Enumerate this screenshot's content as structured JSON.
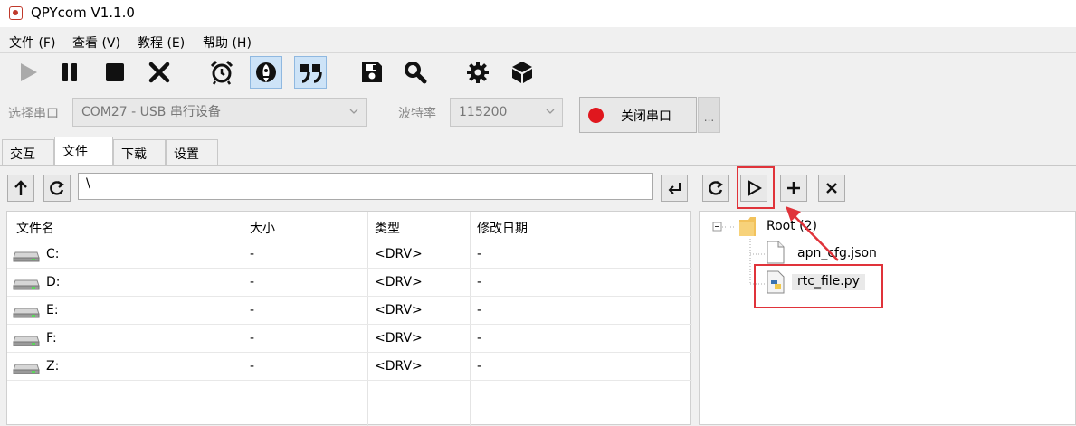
{
  "window": {
    "title": "QPYcom V1.1.0"
  },
  "menu": [
    "文件 (F)",
    "查看 (V)",
    "教程 (E)",
    "帮助 (H)"
  ],
  "toolbar": {
    "icons": [
      "play-icon",
      "pause-icon",
      "stop-icon",
      "close-x-icon",
      "alarm-clock-icon",
      "rocket-icon",
      "quote-icon",
      "save-icon",
      "search-icon",
      "gear-icon",
      "package-box-icon"
    ]
  },
  "serial": {
    "port_label": "选择串口",
    "port_value": "COM27 - USB 串行设备",
    "baud_label": "波特率",
    "baud_value": "115200",
    "close_button": "关闭串口",
    "more_button": "..."
  },
  "tabs": [
    "交互",
    "文件",
    "下载",
    "设置"
  ],
  "active_tab": "文件",
  "local": {
    "path": "\\",
    "columns": [
      "文件名",
      "大小",
      "类型",
      "修改日期"
    ],
    "rows": [
      {
        "name": "C:",
        "size": "-",
        "type": "<DRV>",
        "date": "-"
      },
      {
        "name": "D:",
        "size": "-",
        "type": "<DRV>",
        "date": "-"
      },
      {
        "name": "E:",
        "size": "-",
        "type": "<DRV>",
        "date": "-"
      },
      {
        "name": "F:",
        "size": "-",
        "type": "<DRV>",
        "date": "-"
      },
      {
        "name": "Z:",
        "size": "-",
        "type": "<DRV>",
        "date": "-"
      }
    ]
  },
  "remote": {
    "root_label": "Root (2)",
    "files": [
      "apn_cfg.json",
      "rtc_file.py"
    ]
  },
  "colors": {
    "highlight": "#e0333a",
    "toggle_bg": "#cde3f7",
    "record_dot": "#e0171e"
  }
}
